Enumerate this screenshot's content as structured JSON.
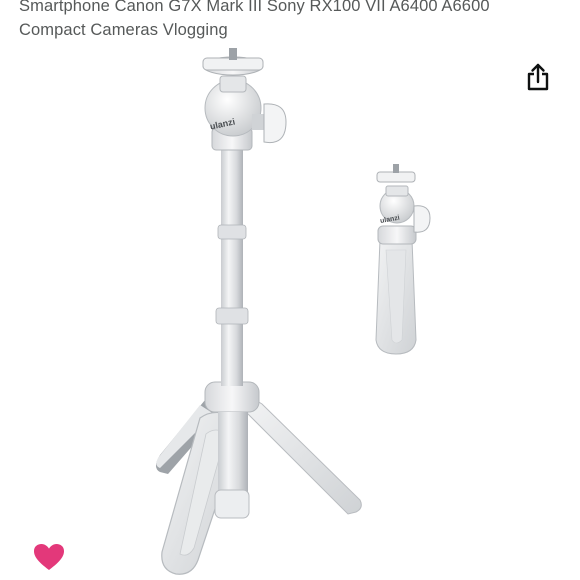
{
  "product": {
    "title_line1": "Smartphone Canon G7X Mark III Sony RX100 VII A6400 A6600",
    "title_line2": "Compact Cameras Vlogging",
    "brand_mark": "ulanzi"
  },
  "actions": {
    "share_icon": "share-icon",
    "favorite_icon": "heart-icon",
    "favorite_color": "#e3387a"
  }
}
